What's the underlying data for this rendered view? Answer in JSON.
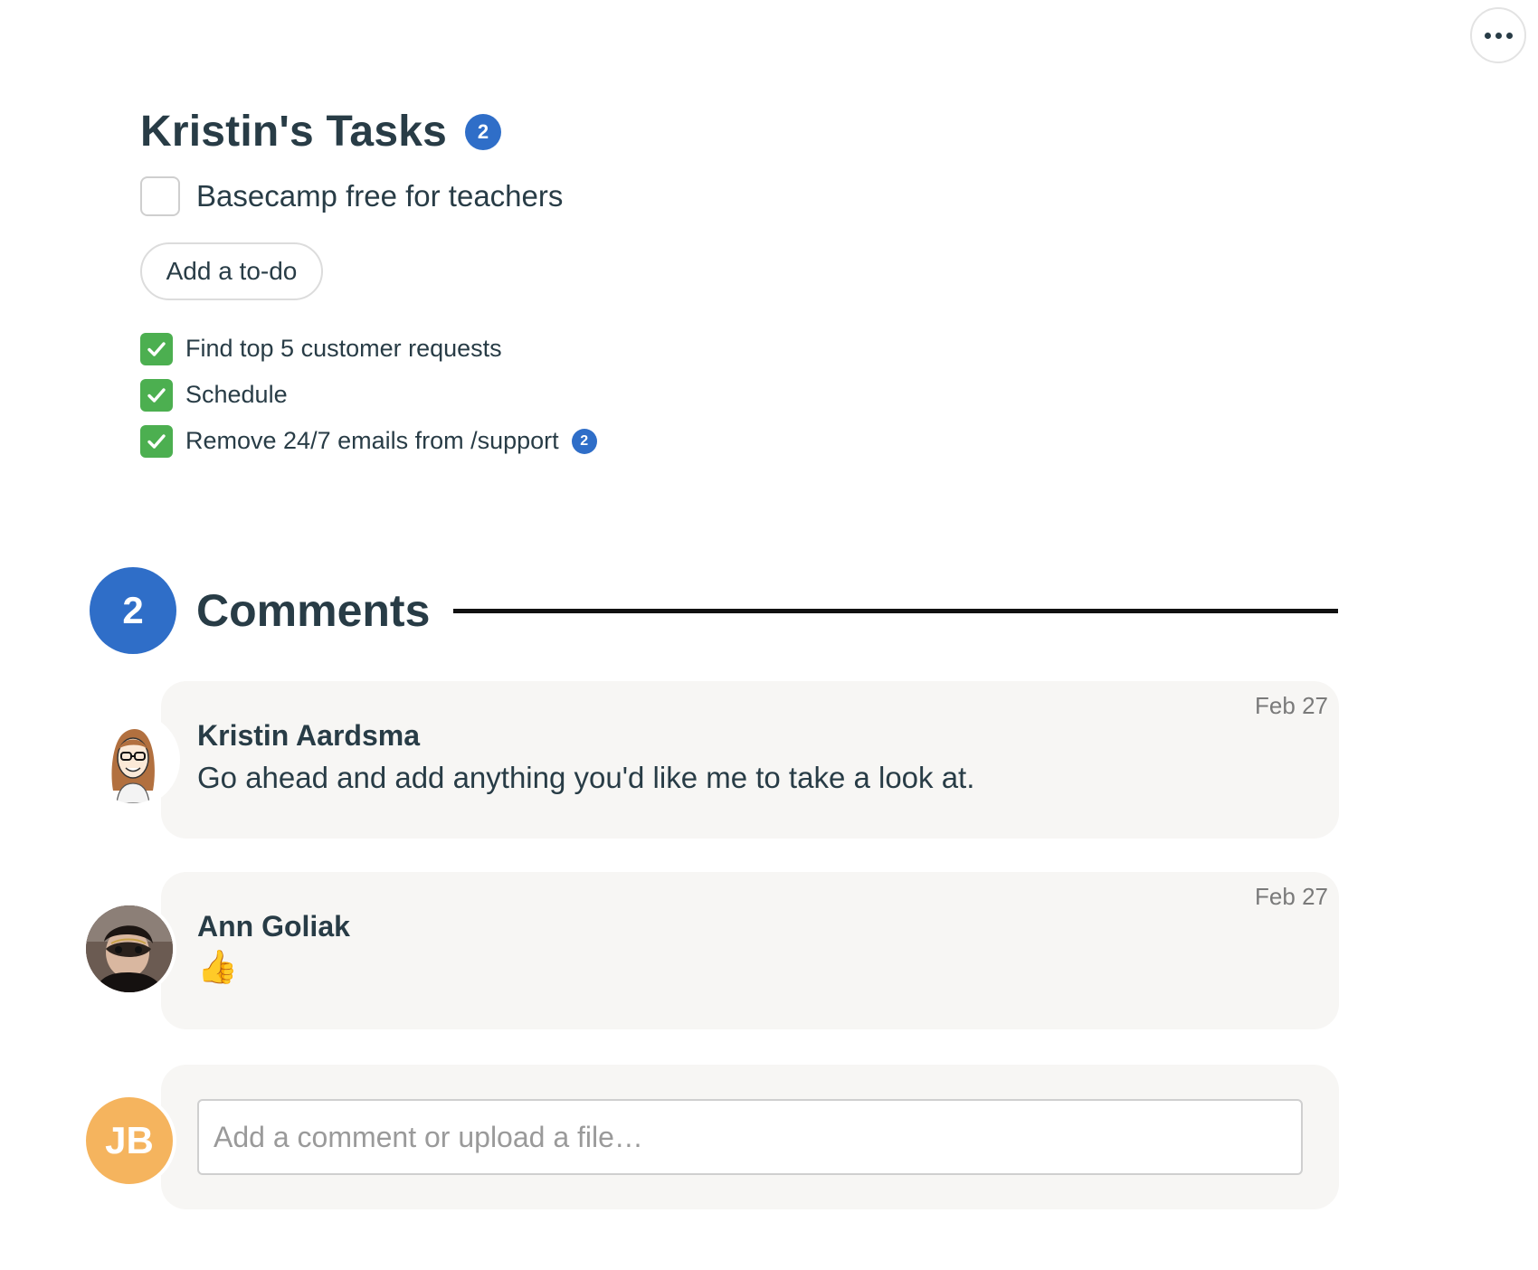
{
  "toolbar": {
    "options_icon": "ellipsis-icon"
  },
  "todolist": {
    "title": "Kristin's Tasks",
    "comment_count": "2",
    "open_items": [
      {
        "label": "Basecamp free for teachers"
      }
    ],
    "add_button_label": "Add a to-do",
    "completed_items": [
      {
        "label": "Find top 5 customer requests",
        "badge": ""
      },
      {
        "label": "Schedule",
        "badge": ""
      },
      {
        "label": "Remove 24/7 emails from /support",
        "badge": "2"
      }
    ]
  },
  "comments": {
    "count": "2",
    "heading": "Comments",
    "items": [
      {
        "author": "Kristin Aardsma",
        "date": "Feb 27",
        "body": "Go ahead and add anything you'd like me to take a look at."
      },
      {
        "author": "Ann Goliak",
        "date": "Feb 27",
        "body": "👍"
      }
    ],
    "composer": {
      "avatar_initials": "JB",
      "placeholder": "Add a comment or upload a file…"
    }
  },
  "colors": {
    "accent": "#2f6ec8",
    "check": "#4caf50",
    "avatar_jb": "#f5b45e",
    "card_bg": "#f7f6f4"
  }
}
